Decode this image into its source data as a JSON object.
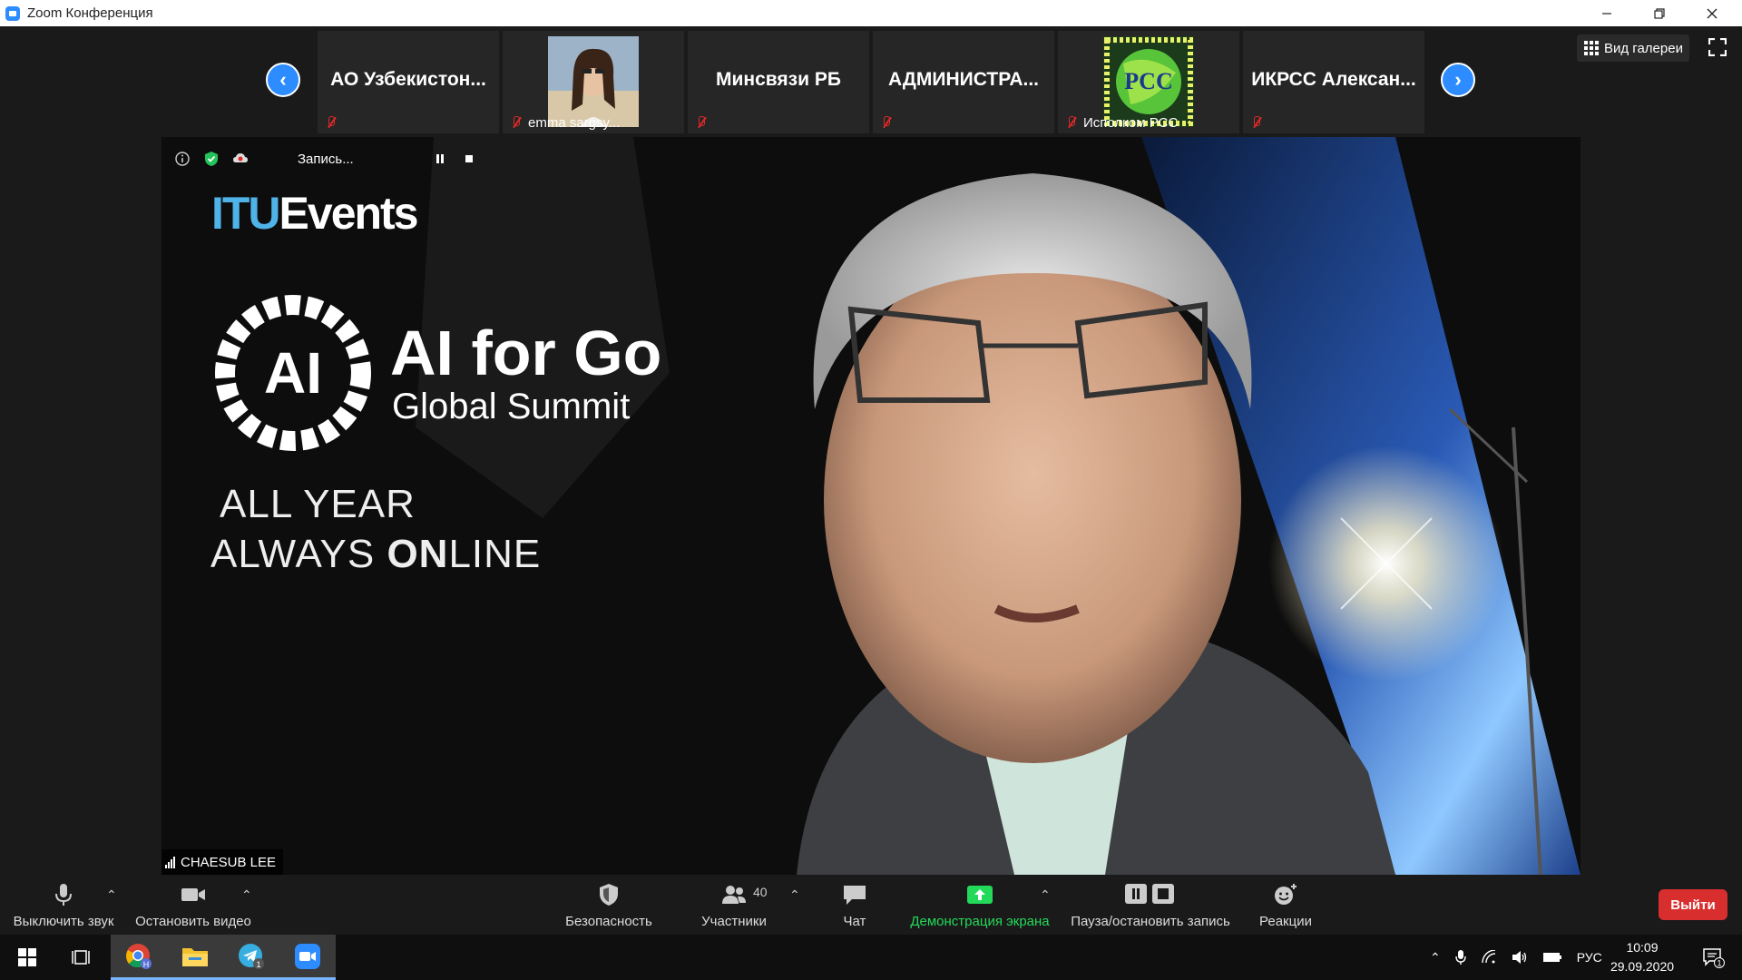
{
  "window": {
    "title": "Zoom Конференция"
  },
  "strip": {
    "participants": [
      {
        "name": "АО Узбекистон...",
        "has_photo": false,
        "sub": ""
      },
      {
        "name": "",
        "has_photo": true,
        "sub": "emma sargsy..."
      },
      {
        "name": "Минсвязи РБ",
        "has_photo": false,
        "sub": ""
      },
      {
        "name": "АДМИНИСТРА...",
        "has_photo": false,
        "sub": ""
      },
      {
        "name": "",
        "has_photo": true,
        "photo_text": "PCC",
        "sub": "Исполком РСС"
      },
      {
        "name": "ИКРСС  Алексан...",
        "has_photo": false,
        "sub": ""
      }
    ],
    "gallery_label": "Вид галереи"
  },
  "video": {
    "recording_label": "Запись...",
    "itu_a": "ITU",
    "itu_b": "Events",
    "logo_text": "AI",
    "ai_title": "AI for Go",
    "ai_subtitle": "Global Summit",
    "year_line": "ALL YEAR",
    "online_a": "ALWAYS ",
    "online_b": "ON",
    "online_c": "LINE",
    "speaker": "CHAESUB LEE"
  },
  "toolbar": {
    "mute": "Выключить звук",
    "video": "Остановить видео",
    "security": "Безопасность",
    "participants": "Участники",
    "participants_count": "40",
    "chat": "Чат",
    "share": "Демонстрация экрана",
    "record": "Пауза/остановить запись",
    "reactions": "Реакции",
    "leave": "Выйти"
  },
  "taskbar": {
    "chrome_badge": "H",
    "telegram_badge": "1",
    "lang": "РУС",
    "time": "10:09",
    "date": "29.09.2020",
    "notif_count": "1"
  },
  "colors": {
    "accent": "#2d8cff",
    "share_green": "#23d959",
    "leave_red": "#d92e2e",
    "mute_red": "#e02828"
  }
}
